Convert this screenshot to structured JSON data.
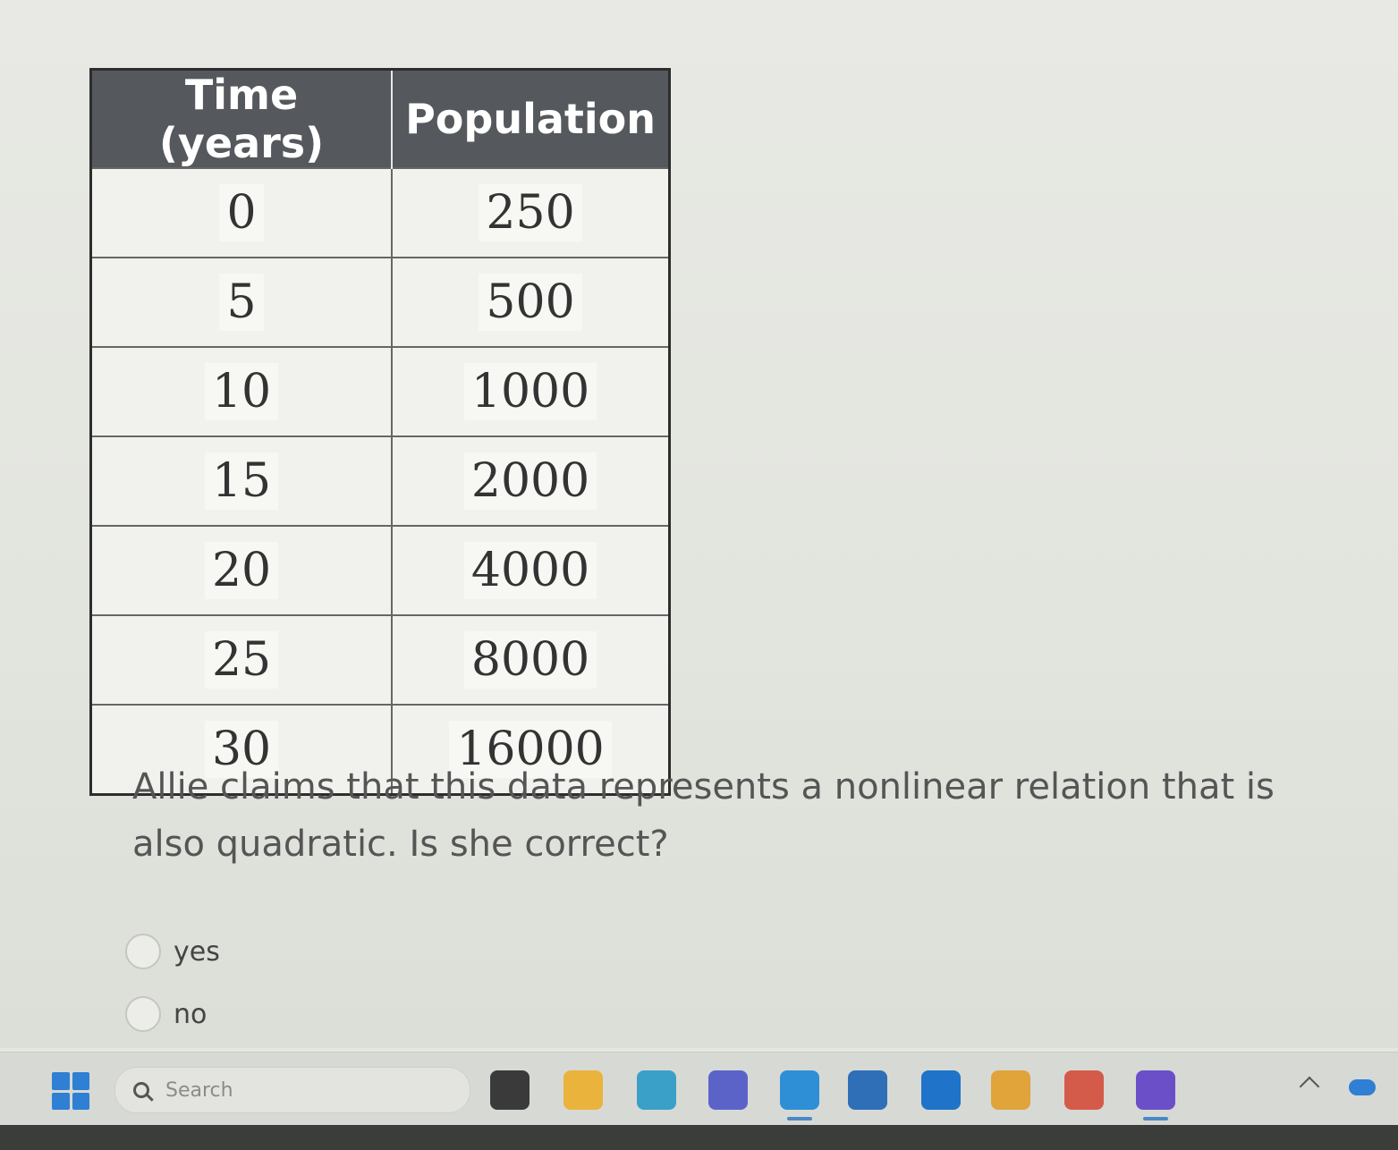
{
  "table": {
    "headers": [
      "Time (years)",
      "Population"
    ],
    "rows": [
      [
        "0",
        "250"
      ],
      [
        "5",
        "500"
      ],
      [
        "10",
        "1000"
      ],
      [
        "15",
        "2000"
      ],
      [
        "20",
        "4000"
      ],
      [
        "25",
        "8000"
      ],
      [
        "30",
        "16000"
      ]
    ]
  },
  "question": {
    "prompt": "Allie claims that this data represents a nonlinear relation that is also quadratic. Is she correct?",
    "options": [
      "yes",
      "no"
    ],
    "selected": null
  },
  "taskbar": {
    "search_placeholder": "Search",
    "apps": [
      {
        "icon": "task-view-icon",
        "color": "#3a3a3a"
      },
      {
        "icon": "file-explorer-icon",
        "color": "#e9b33c"
      },
      {
        "icon": "copilot-icon",
        "color": "#3aa0c8"
      },
      {
        "icon": "teams-icon",
        "color": "#5b63c9"
      },
      {
        "icon": "edge-icon",
        "color": "#2e8fd6"
      },
      {
        "icon": "microsoft-store-icon",
        "color": "#2f6fb8"
      },
      {
        "icon": "outlook-icon",
        "color": "#1f73c9"
      },
      {
        "icon": "chrome-icon",
        "color": "#e0a43a"
      },
      {
        "icon": "chrome-profile-icon",
        "color": "#d45b4a"
      },
      {
        "icon": "whiteboard-icon",
        "color": "#6b4fc9"
      }
    ]
  }
}
